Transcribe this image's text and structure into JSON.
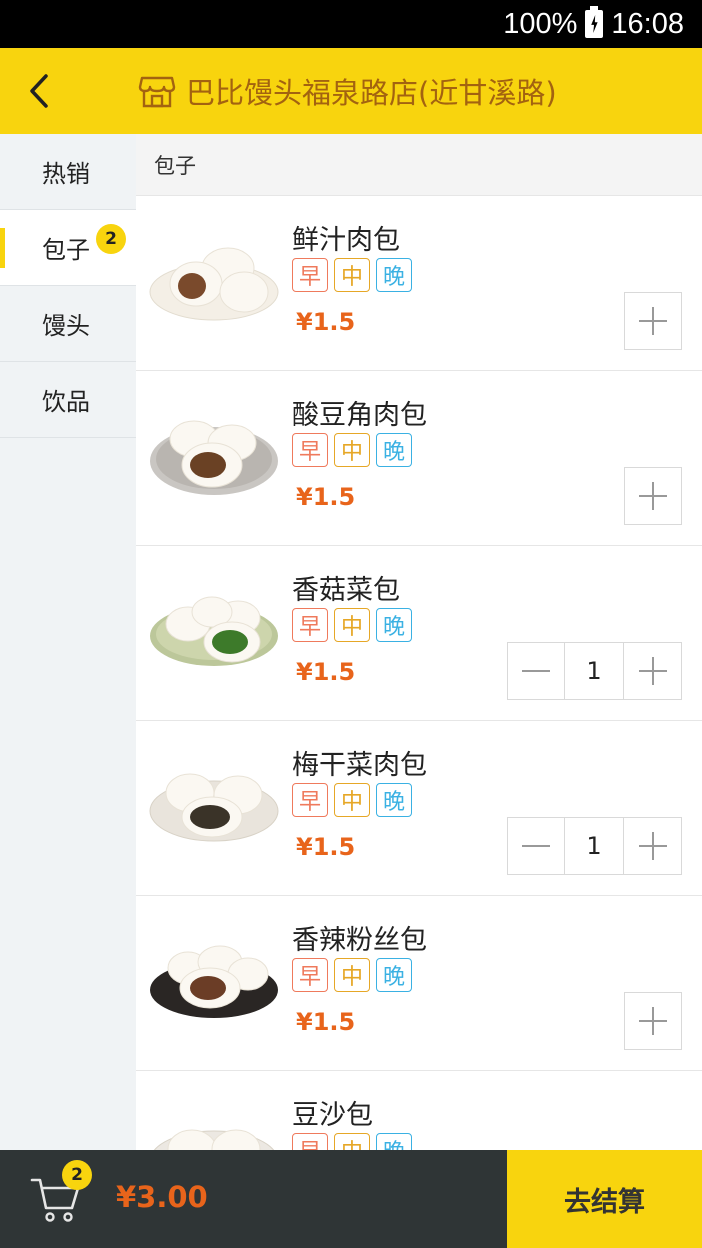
{
  "status_bar": {
    "battery": "100%",
    "time": "16:08"
  },
  "header": {
    "title": "巴比馒头福泉路店(近甘溪路)",
    "back_icon": "chevron-left-icon",
    "store_icon": "store-icon",
    "accent": "#f8d40e"
  },
  "sidebar": {
    "items": [
      {
        "label": "热销",
        "badge": ""
      },
      {
        "label": "包子",
        "badge": "2"
      },
      {
        "label": "馒头",
        "badge": ""
      },
      {
        "label": "饮品",
        "badge": ""
      }
    ],
    "active_index": 1
  },
  "content": {
    "category": "包子",
    "tags": {
      "breakfast": "早",
      "lunch": "中",
      "dinner": "晚"
    },
    "products": [
      {
        "name": "鲜汁肉包",
        "price": "¥1.5",
        "qty": ""
      },
      {
        "name": "酸豆角肉包",
        "price": "¥1.5",
        "qty": ""
      },
      {
        "name": "香菇菜包",
        "price": "¥1.5",
        "qty": "1"
      },
      {
        "name": "梅干菜肉包",
        "price": "¥1.5",
        "qty": "1"
      },
      {
        "name": "香辣粉丝包",
        "price": "¥1.5",
        "qty": ""
      },
      {
        "name": "豆沙包",
        "price": "",
        "qty": ""
      }
    ]
  },
  "cart": {
    "count": "2",
    "total": "¥3.00",
    "checkout_label": "去结算"
  },
  "colors": {
    "price": "#e8641b",
    "tag_breakfast": "#ef7a5c",
    "tag_lunch": "#e6a726",
    "tag_dinner": "#3ab1e3"
  }
}
